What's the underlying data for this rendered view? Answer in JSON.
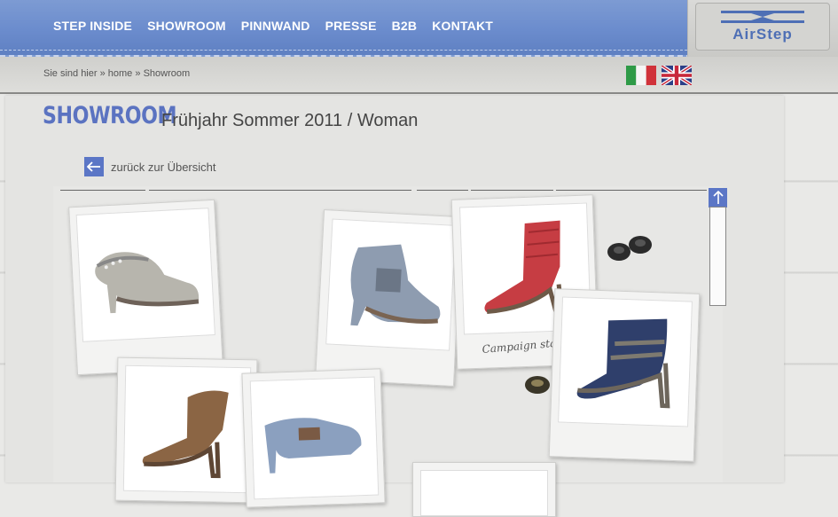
{
  "nav": {
    "items": [
      {
        "label": "STEP INSIDE"
      },
      {
        "label": "SHOWROOM"
      },
      {
        "label": "PINNWAND"
      },
      {
        "label": "PRESSE"
      },
      {
        "label": "B2B"
      },
      {
        "label": "KONTAKT"
      }
    ]
  },
  "brand": {
    "name": "AirStep",
    "color": "#4e6fb5"
  },
  "breadcrumb": {
    "prefix": "Sie sind hier »",
    "home": "home",
    "sep": "»",
    "current": "Showroom"
  },
  "languages": [
    {
      "name": "italian-flag-icon"
    },
    {
      "name": "uk-flag-icon"
    }
  ],
  "page": {
    "title_logo": "SHOWROOM",
    "subtitle": "Frühjahr Sommer 2011 / Woman",
    "back_label": "zurück zur Übersicht"
  },
  "products": [
    {
      "name": "strappy-slingback-sandal",
      "caption": ""
    },
    {
      "name": "grey-studded-ankle-bootie",
      "caption": ""
    },
    {
      "name": "red-strap-gladiator-sandal",
      "caption": "Campaign star"
    },
    {
      "name": "navy-buckle-bootie",
      "caption": ""
    },
    {
      "name": "brown-wrap-sandal",
      "caption": ""
    },
    {
      "name": "blue-buckle-clog",
      "caption": ""
    }
  ],
  "colors": {
    "accent": "#5b76c6",
    "denim": "#6b8ccd"
  }
}
